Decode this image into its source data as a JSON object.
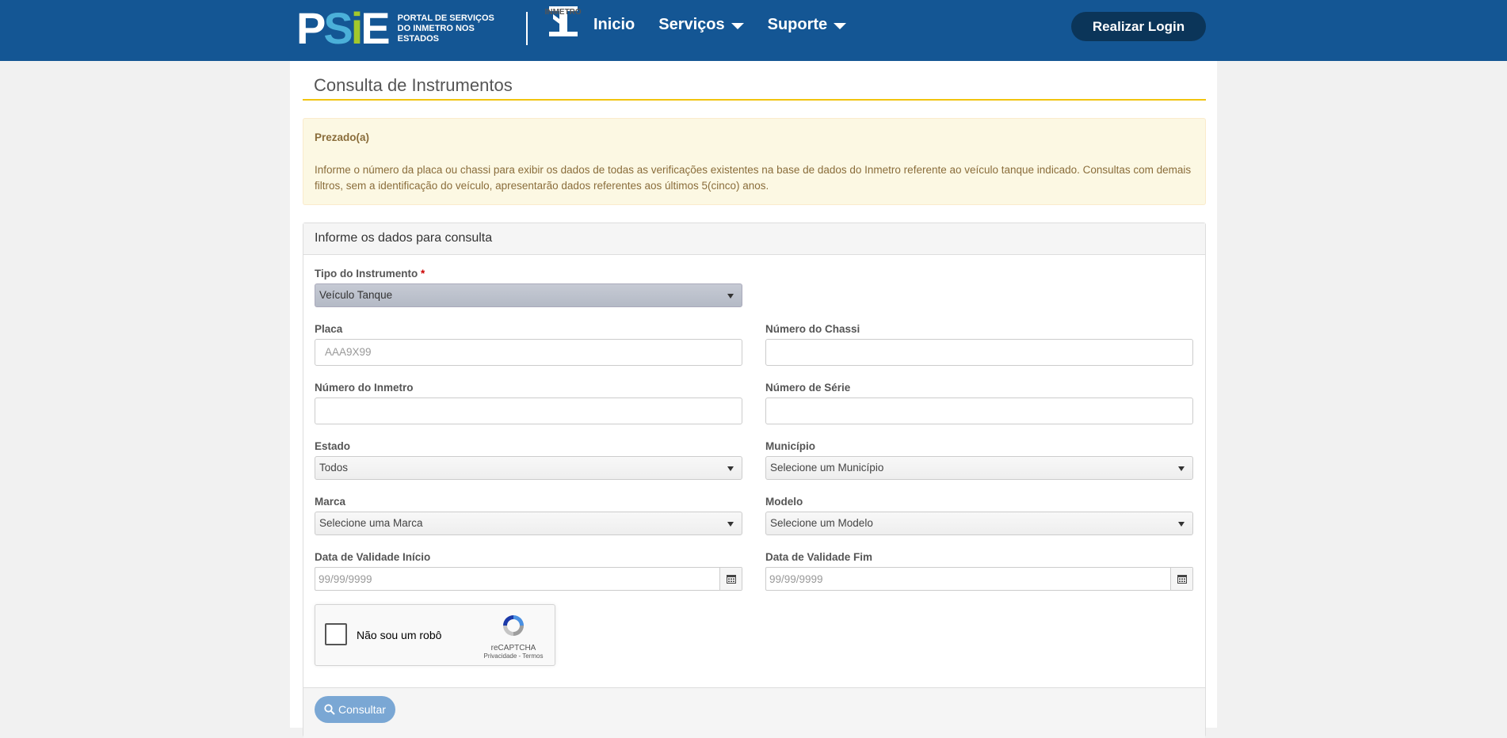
{
  "header": {
    "logo_text": "PSIE",
    "portal_line1": "PORTAL DE SERVIÇOS",
    "portal_line2": "DO INMETRO NOS ESTADOS",
    "inmetro_label": "INMETRO",
    "nav": {
      "inicio": "Inicio",
      "servicos": "Serviços",
      "suporte": "Suporte"
    },
    "login_label": "Realizar Login",
    "bg_color": "#145694"
  },
  "page": {
    "title": "Consulta de Instrumentos",
    "alert_title": "Prezado(a)",
    "alert_body": "Informe o número da placa ou chassi para exibir os dados de todas as verificações existentes na base de dados do Inmetro referente ao veículo tanque indicado. Consultas com demais filtros, sem a identificação do veículo, apresentarão dados referentes aos últimos 5(cinco) anos."
  },
  "form": {
    "panel_title": "Informe os dados para consulta",
    "tipo_label": "Tipo do Instrumento",
    "required_mark": "*",
    "tipo_value": "Veículo Tanque",
    "placa_label": "Placa",
    "placa_placeholder": "AAA9X99",
    "chassi_label": "Número do Chassi",
    "inmetro_label": "Número do Inmetro",
    "serie_label": "Número de Série",
    "estado_label": "Estado",
    "estado_value": "Todos",
    "municipio_label": "Município",
    "municipio_value": "Selecione um Município",
    "marca_label": "Marca",
    "marca_value": "Selecione uma Marca",
    "modelo_label": "Modelo",
    "modelo_value": "Selecione um Modelo",
    "validade_inicio_label": "Data de Validade Início",
    "validade_inicio_placeholder": "99/99/9999",
    "validade_fim_label": "Data de Validade Fim",
    "validade_fim_placeholder": "99/99/9999",
    "captcha_text": "Não sou um robô",
    "captcha_brand": "reCAPTCHA",
    "captcha_links": "Privacidade - Termos",
    "submit_label": "Consultar"
  }
}
